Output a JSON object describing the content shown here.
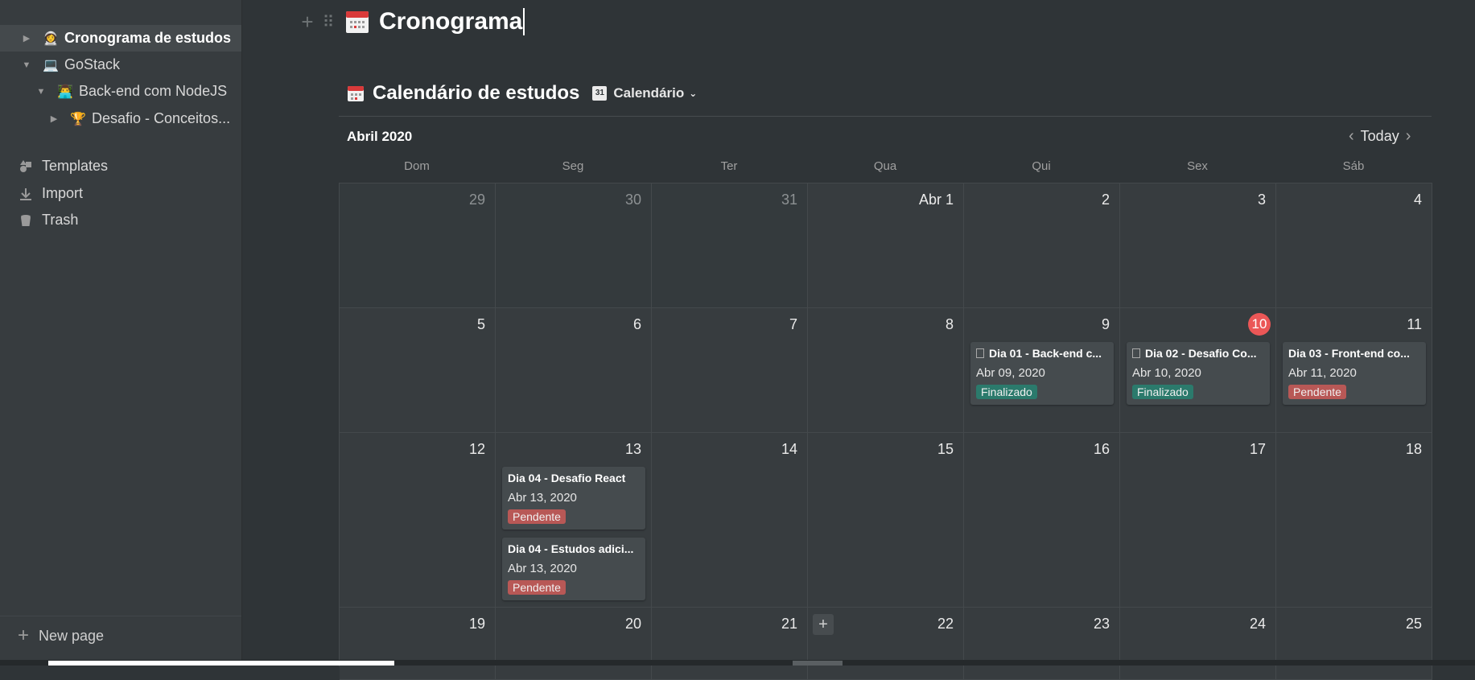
{
  "sidebar": {
    "tree": [
      {
        "label": "Cronograma de estudos",
        "emoji": "👩‍🚀",
        "caret": "▶",
        "active": true
      },
      {
        "label": "GoStack",
        "emoji": "💻",
        "caret": "▼"
      },
      {
        "label": "Back-end com NodeJS",
        "emoji": "👨‍💻",
        "caret": "▼"
      },
      {
        "label": "Desafio - Conceitos...",
        "emoji": "🏆",
        "caret": "▶"
      }
    ],
    "actions": [
      {
        "label": "Templates",
        "icon": "templates-icon"
      },
      {
        "label": "Import",
        "icon": "import-icon"
      },
      {
        "label": "Trash",
        "icon": "trash-icon"
      }
    ],
    "new_page": "New page"
  },
  "page": {
    "title": "Cronograma",
    "icon": "calendar-icon"
  },
  "calendar": {
    "title": "Calendário de estudos",
    "view_label": "Calendário",
    "view_icon_text": "31",
    "month_label": "Abril 2020",
    "today_label": "Today",
    "weekdays": [
      "Dom",
      "Seg",
      "Ter",
      "Qua",
      "Qui",
      "Sex",
      "Sáb"
    ],
    "weeks": [
      [
        "29",
        "30",
        "31",
        "Abr 1",
        "2",
        "3",
        "4"
      ],
      [
        "5",
        "6",
        "7",
        "8",
        "9",
        "10",
        "11"
      ],
      [
        "12",
        "13",
        "14",
        "15",
        "16",
        "17",
        "18"
      ],
      [
        "19",
        "20",
        "21",
        "22",
        "23",
        "24",
        "25"
      ]
    ],
    "today": "10",
    "events": [
      {
        "title": "Dia 01 - Back-end c...",
        "date": "Abr 09, 2020",
        "status": "Finalizado",
        "has_doc_icon": true
      },
      {
        "title": "Dia 02 - Desafio Co...",
        "date": "Abr 10, 2020",
        "status": "Finalizado",
        "has_doc_icon": true
      },
      {
        "title": "Dia 03 - Front-end co...",
        "date": "Abr 11, 2020",
        "status": "Pendente",
        "has_doc_icon": false
      },
      {
        "title": "Dia 04 - Desafio React",
        "date": "Abr 13, 2020",
        "status": "Pendente",
        "has_doc_icon": false
      },
      {
        "title": "Dia 04 - Estudos adici...",
        "date": "Abr 13, 2020",
        "status": "Pendente",
        "has_doc_icon": false
      }
    ],
    "status_colors": {
      "Finalizado": "#2b7a6c",
      "Pendente": "#b85856"
    },
    "today_color": "#eb5757"
  }
}
